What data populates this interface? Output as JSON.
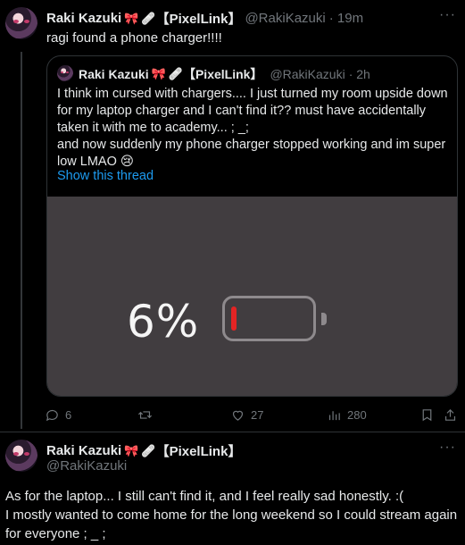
{
  "reply": {
    "author_name": "Raki Kazuki",
    "author_badge": "【PixelLink】",
    "author_handle": "@RakiKazuki",
    "time": "· 19m",
    "text": "ragi found a phone charger!!!!",
    "more": "···"
  },
  "quoted": {
    "author_name": "Raki Kazuki",
    "author_badge": "【PixelLink】",
    "author_handle": "@RakiKazuki",
    "time": "· 2h",
    "text_line1": "I think im cursed with chargers.... I just turned my room upside down for my laptop charger and I can't find it?? must have accidentally taken it with me to academy... ; _;",
    "text_line2": "and now suddenly my phone charger stopped working and im super low LMAO 😢",
    "show_thread": "Show this thread",
    "media": {
      "battery_percent_label": "6%",
      "battery_level": 0.06,
      "battery_fill_color": "#e32424"
    }
  },
  "actions": {
    "replies": "6",
    "retweets": "",
    "likes": "27",
    "views": "280"
  },
  "next_tweet": {
    "author_name": "Raki Kazuki",
    "author_badge": "【PixelLink】",
    "author_handle": "@RakiKazuki",
    "more": "···",
    "line1": "As for the laptop... I still can't find it, and I feel really sad honestly. :(",
    "line2": "I mostly wanted to come home for the long weekend so I could stream again for everyone ; _ ;"
  },
  "icons": {
    "bow": "bow-emoji-icon",
    "plaster": "bandage-emoji-icon",
    "reply": "reply-icon",
    "retweet": "retweet-icon",
    "like": "heart-icon",
    "views": "views-icon",
    "bookmark": "bookmark-icon",
    "share": "share-icon"
  },
  "colors": {
    "link": "#1d9bf0",
    "muted": "#71767b",
    "background": "#000000"
  }
}
